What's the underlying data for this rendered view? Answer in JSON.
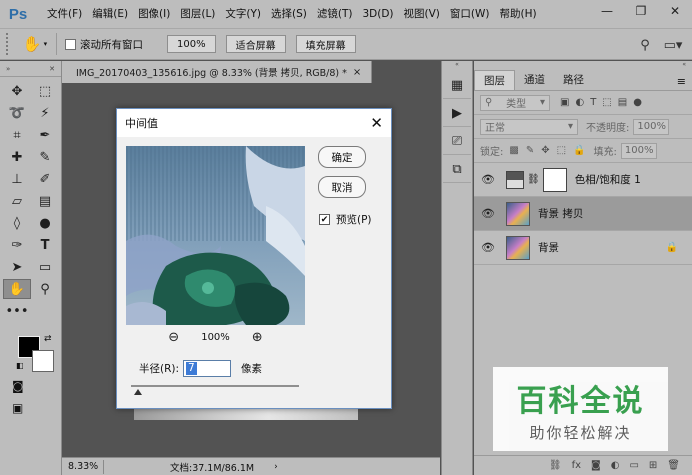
{
  "app": {
    "logo": "Ps"
  },
  "menu": [
    "文件(F)",
    "编辑(E)",
    "图像(I)",
    "图层(L)",
    "文字(Y)",
    "选择(S)",
    "滤镜(T)",
    "3D(D)",
    "视图(V)",
    "窗口(W)",
    "帮助(H)"
  ],
  "window_controls": {
    "minimize": "—",
    "restore": "❐",
    "close": "✕"
  },
  "options": {
    "scroll_all": "滚动所有窗口",
    "zoom_value": "100%",
    "fit_screen": "适合屏幕",
    "fill_screen": "填充屏幕"
  },
  "document": {
    "tab_title": "IMG_20170403_135616.jpg @ 8.33% (背景 拷贝, RGB/8) *",
    "tab_close": "×",
    "zoom": "8.33%",
    "info": "文档:37.1M/86.1M",
    "status_arrow": "›"
  },
  "dialog": {
    "title": "中间值",
    "close": "✕",
    "ok": "确定",
    "cancel": "取消",
    "preview_label": "预览(P)",
    "preview_checked": true,
    "zoom_percent": "100%",
    "radius_label": "半径(R):",
    "radius_value": "7",
    "unit": "像素"
  },
  "layers_panel": {
    "tabs": [
      "图层",
      "通道",
      "路径"
    ],
    "filter_kind": "类型",
    "blend_mode": "正常",
    "opacity_label": "不透明度:",
    "opacity_value": "100%",
    "lock_label": "锁定:",
    "fill_label": "填充:",
    "fill_value": "100%",
    "layers": [
      {
        "name": "色相/饱和度 1",
        "type": "adjustment",
        "selected": false
      },
      {
        "name": "背景 拷贝",
        "type": "image",
        "selected": true
      },
      {
        "name": "背景",
        "type": "image",
        "selected": false,
        "locked": true
      }
    ]
  },
  "watermark": {
    "title": "百科全说",
    "subtitle": "助你轻松解决"
  },
  "colors": {
    "chrome": "#bdbdbd",
    "canvas": "#535353",
    "selection": "#3d7bd6",
    "watermark_green": "#2e9e46"
  }
}
